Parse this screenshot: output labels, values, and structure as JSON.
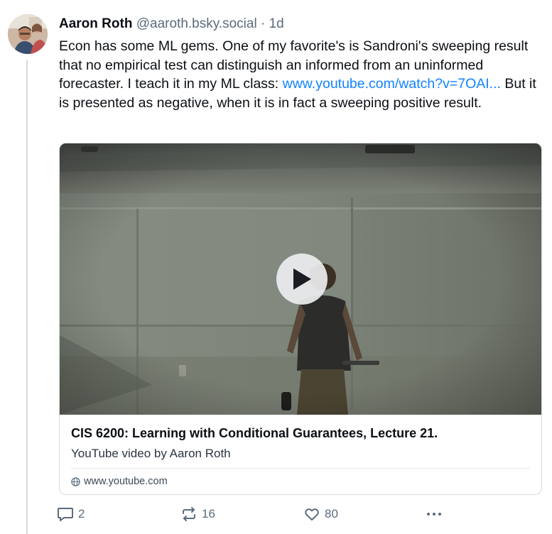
{
  "post": {
    "author_name": "Aaron Roth",
    "author_handle": "@aaroth.bsky.social",
    "separator": "·",
    "timestamp": "1d",
    "text_part1": "Econ has some ML gems. One of my favorite's is Sandroni's sweeping result that no empirical test can distinguish an informed from an uninformed forecaster. I teach it in my ML class: ",
    "link_text": "www.youtube.com/watch?v=7OAI...",
    "text_part2": " But it is presented as negative, when it is in fact a sweeping positive result."
  },
  "embed": {
    "title": "CIS 6200: Learning with Conditional Guarantees, Lecture 21.",
    "description": "YouTube video by Aaron Roth",
    "domain": "www.youtube.com",
    "play_icon": "play-icon",
    "globe_icon": "globe-icon"
  },
  "actions": {
    "reply_count": "2",
    "repost_count": "16",
    "like_count": "80",
    "reply_icon": "reply-icon",
    "repost_icon": "repost-icon",
    "like_icon": "heart-icon",
    "more_icon": "more-icon"
  },
  "colors": {
    "link": "#1083fe",
    "muted": "#5b6b7c",
    "border": "#d4dbe2"
  }
}
